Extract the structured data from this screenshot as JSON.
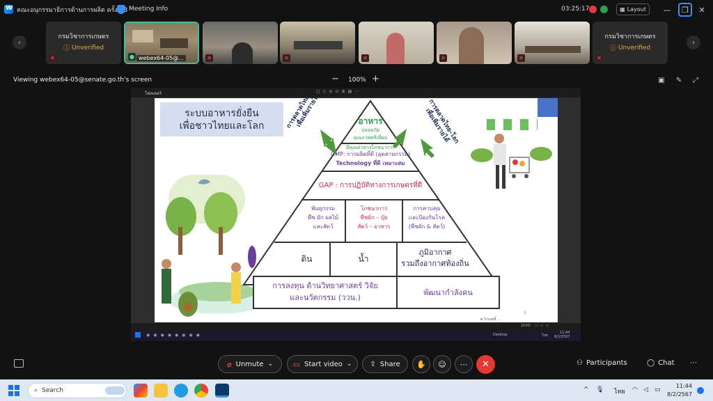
{
  "window": {
    "meeting_title": "คณะอนุกรรมาธิการด้านการผลิต ครั้งที่ 3",
    "meeting_info_label": "Meeting Info",
    "elapsed_time": "03:25:17",
    "layout_label": "Layout"
  },
  "participants": [
    {
      "name": "กรมวิชาการเกษตร",
      "status": "Unverified"
    },
    {
      "name": "webex64-05@..."
    },
    {
      "name": ""
    },
    {
      "name": ""
    },
    {
      "name": ""
    },
    {
      "name": ""
    },
    {
      "name": ""
    },
    {
      "name": "กรมวิชาการเกษตร",
      "status": "Unverified"
    }
  ],
  "share": {
    "viewing_label": "Viewing webex64-05@senate.go.th's screen",
    "zoom": "100%",
    "app_title": "โฟลเดอร์"
  },
  "slide": {
    "title_line1": "ระบบอาหารยั่งยืน",
    "title_line2": "เพื่อชาวไทยและโลก",
    "left_arrow_line1": "การตลาดไทย-โลก",
    "left_arrow_line2": "เพื่อเพิ่มรายได้",
    "right_arrow_line1": "การตลาดไทย-โลก",
    "right_arrow_line2": "เพื่อเพิ่มรายได้",
    "apex_title": "อาหาร",
    "apex_line1": "ปลอดภัย",
    "apex_line2": "คุณภาพพรีเมี่ยม",
    "apex_line3": "มีคุณค่าทางโภชนาการ",
    "gmp_line1": "GMP: การผลิตที่ดี (อุตสาหกรรม)",
    "gmp_line2": "Technology ที่ดี เหมาะสม",
    "gap_line": "GAP : การปฏิบัติทางการเกษตรที่ดี",
    "c1_line1": "พันธุกรรม",
    "c1_line2": "พืช ผัก ผลไม้",
    "c1_line3": "และสัตว์",
    "c2_line1": "โภชนาการ",
    "c2_line2": "พืชผัก – ปุ๋ย",
    "c2_line3": "สัตว์ – อาหาร",
    "c3_line1": "การควบคุม",
    "c3_line2": "และป้องกันโรค",
    "c3_line3": "(พืชผัก & สัตว์)",
    "soil": "ดิน",
    "water": "น้ำ",
    "climate_line1": "ภูมิอากาศ",
    "climate_line2": "รวมถึงอากาศท้องถิ่น",
    "base_left_line1": "การลงทุน ด้านวิทยาศาสตร์ วิจัย",
    "base_left_line2": "และนวัตกรรม (ววน.)",
    "base_right": "พัฒนากำลังคน",
    "page_number": "3",
    "author": "ศ.ไกรฤทธิ์ ...",
    "zoom_inner": "214%",
    "inner_clock_time": "11:44",
    "inner_clock_date": "8/2/2567",
    "inner_lang": "ไทย",
    "inner_desktop": "Desktop"
  },
  "controls": {
    "unmute": "Unmute",
    "start_video": "Start video",
    "share": "Share",
    "participants": "Participants",
    "chat": "Chat"
  },
  "taskbar": {
    "search_placeholder": "Search",
    "lang": "ไทย",
    "time": "11:44",
    "date": "8/2/2567"
  },
  "colors": {
    "accent_green": "#3fbf9f",
    "end_red": "#e53935",
    "muted_red": "#ff5252",
    "unverified_orange": "#e8a93c",
    "pyramid_green": "#2e9e4f",
    "pyramid_purple": "#6b3fa0",
    "pyramid_red": "#d0304b",
    "pyramid_navy": "#1f2d52"
  }
}
